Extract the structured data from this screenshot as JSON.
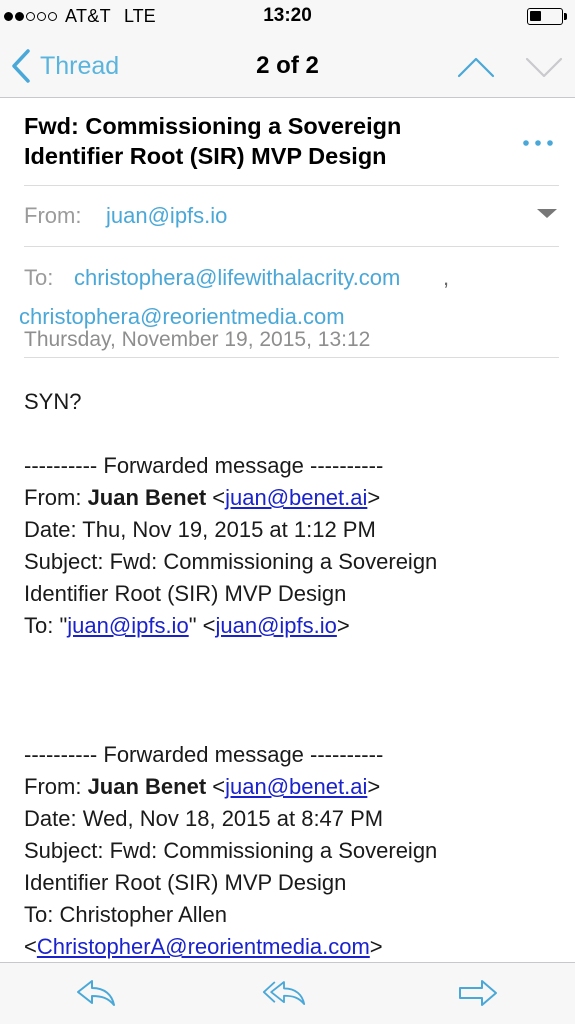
{
  "status_bar": {
    "carrier": "AT&T",
    "network": "LTE",
    "time": "13:20",
    "signal_bars_filled": 2,
    "signal_bars_total": 5,
    "battery_level": 0.35
  },
  "nav": {
    "back_label": "Thread",
    "counter": "2 of 2",
    "icons": [
      "chevron-left-icon",
      "chevron-up-icon",
      "chevron-down-icon"
    ]
  },
  "message": {
    "subject": "Fwd: Commissioning a Sovereign Identifier Root (SIR) MVP Design",
    "from_label": "From:",
    "from_address": "juan@ipfs.io",
    "to_label": "To:",
    "to_address_1": "christophera@lifewithalacrity.com",
    "to_comma": ",",
    "to_address_2": "christophera@reorientmedia.com",
    "date": "Thursday, November 19, 2015, 13:12"
  },
  "body": {
    "greeting": "SYN?",
    "forward_1": {
      "divider": "---------- Forwarded message ----------",
      "from_prefix": "From: ",
      "from_name": "Juan Benet",
      "from_email": "juan@benet.ai",
      "date": "Date: Thu, Nov 19, 2015 at 1:12 PM",
      "subject_line_1": "Subject: Fwd: Commissioning a Sovereign",
      "subject_line_2": "Identifier Root (SIR) MVP Design",
      "to_prefix": "To: \"",
      "to_email_quoted": "juan@ipfs.io",
      "to_middle": "\" <",
      "to_email": "juan@ipfs.io",
      "to_suffix": ">"
    },
    "forward_2": {
      "divider": "---------- Forwarded message ----------",
      "from_prefix": "From: ",
      "from_name": "Juan Benet",
      "from_email": "juan@benet.ai",
      "date": "Date: Wed, Nov 18, 2015 at 8:47 PM",
      "subject_line_1": "Subject: Fwd: Commissioning a Sovereign",
      "subject_line_2": "Identifier Root (SIR) MVP Design",
      "to_line": "To: Christopher Allen",
      "to_email": "ChristopherA@reorientmedia.com"
    }
  },
  "toolbar": {
    "icons": [
      "reply-icon",
      "reply-all-icon",
      "forward-icon"
    ]
  },
  "colors": {
    "accent": "#4aa8d8",
    "link": "#1a22cc",
    "bar_background": "#f7f7f7",
    "label_gray": "#9b9b9b"
  }
}
